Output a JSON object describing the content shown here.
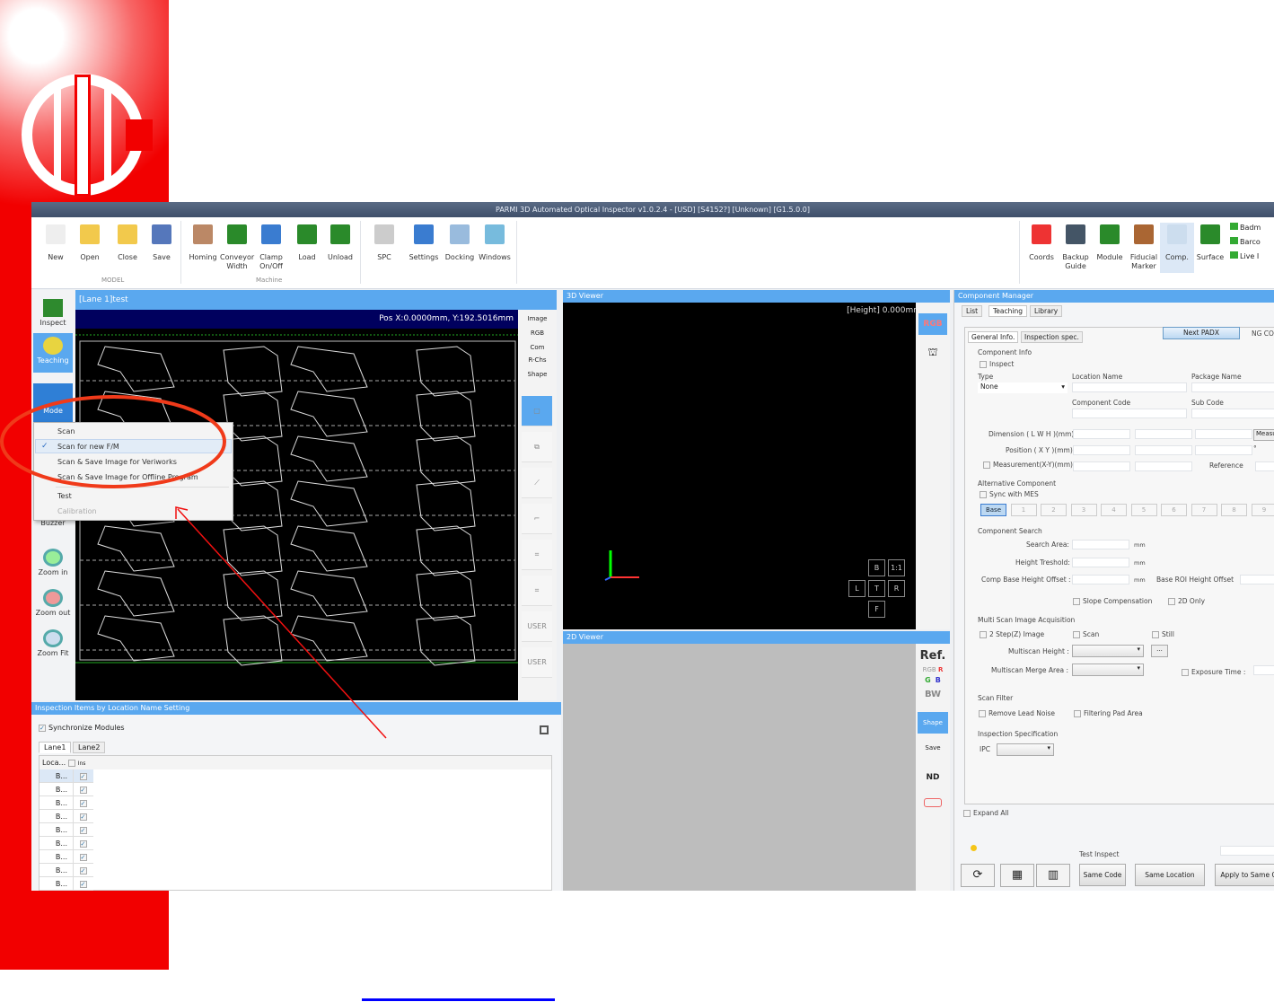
{
  "slide": {
    "link_color": "#0000ff",
    "brand_red": "#f20000"
  },
  "window": {
    "title": "PARMI 3D Automated Optical Inspector v1.0.2.4 - [USD] [S4152?] [Unknown] [G1.5.0.0]"
  },
  "ribbon": {
    "items": [
      {
        "label": "New",
        "icon": "new-file-icon"
      },
      {
        "label": "Open",
        "icon": "open-folder-icon"
      },
      {
        "label": "Close",
        "icon": "close-folder-icon"
      },
      {
        "label": "Save",
        "icon": "save-disk-icon"
      },
      {
        "label": "Homing",
        "icon": "homing-icon"
      },
      {
        "label": "Conveyor Width",
        "icon": "conveyor-icon"
      },
      {
        "label": "Clamp On/Off",
        "icon": "clamp-icon"
      },
      {
        "label": "Load",
        "icon": "load-icon"
      },
      {
        "label": "Unload",
        "icon": "unload-icon"
      },
      {
        "label": "SPC",
        "icon": "spc-icon"
      },
      {
        "label": "Settings",
        "icon": "gear-icon"
      },
      {
        "label": "Docking",
        "icon": "docking-icon"
      },
      {
        "label": "Windows",
        "icon": "windows-icon"
      },
      {
        "label": "Coords",
        "icon": "coords-icon"
      },
      {
        "label": "Backup Guide",
        "icon": "backup-guide-icon"
      },
      {
        "label": "Module",
        "icon": "module-icon"
      },
      {
        "label": "Fiducial Marker",
        "icon": "fiducial-icon"
      },
      {
        "label": "Comp.",
        "icon": "component-icon"
      },
      {
        "label": "Surface",
        "icon": "surface-icon"
      }
    ],
    "groups": [
      "MODEL",
      "Machine"
    ],
    "small_items": [
      "Badm",
      "Barco",
      "Live I"
    ]
  },
  "left_toolbar": {
    "items": [
      "Inspect",
      "Teaching",
      "Mode",
      "Buzzer",
      "Zoom in",
      "Zoom out",
      "Zoom Fit"
    ]
  },
  "mode_menu": {
    "items": [
      "Scan",
      "Scan for new F/M",
      "Scan & Save Image for Veriworks",
      "Scan & Save Image for Offline Program",
      "Test",
      "Calibration"
    ],
    "checked": "Scan for new F/M"
  },
  "main_view": {
    "title": "[Lane 1]test",
    "position": "Pos X:0.0000mm, Y:192.5016mm",
    "side_tools": {
      "image_label": "Image",
      "image_value": "RGB",
      "com_label": "Com",
      "com_value": "R-Chs",
      "shape_label": "Shape",
      "user1": "USER",
      "user2": "USER"
    }
  },
  "viewer3d": {
    "title": "3D Viewer",
    "height": "[Height] 0.000mm",
    "buttons": [
      "B",
      "1:1",
      "L",
      "T",
      "R",
      "F"
    ],
    "rgb": "RGB"
  },
  "viewer2d": {
    "title": "2D Viewer",
    "tools": [
      "Ref.",
      "RGB",
      "R",
      "G",
      "B",
      "BW",
      "Shape",
      "Save",
      "ND"
    ]
  },
  "inspection_items": {
    "title": "Inspection Items by Location Name Setting",
    "sync": "Synchronize Modules",
    "tabs": [
      "Lane1",
      "Lane2"
    ],
    "col_loc": "Loca...",
    "col_ins": "Ins",
    "rows": [
      "B...",
      "B...",
      "B...",
      "B...",
      "B...",
      "B...",
      "B...",
      "B...",
      "B..."
    ]
  },
  "component_manager": {
    "title": "Component Manager",
    "tabs": [
      "List",
      "Teaching",
      "Library"
    ],
    "subtabs": [
      "General Info.",
      "Inspection spec."
    ],
    "next_btn": "Next PADX",
    "ng": "NG COM",
    "component_info": "Component Info",
    "inspect": "Inspect",
    "type_label": "Type",
    "type_value": "None",
    "location_name": "Location Name",
    "package_name": "Package Name",
    "component_code": "Component Code",
    "sub_code": "Sub Code",
    "dimension": "Dimension ( L W H )(mm)",
    "measure_btn": "Measu",
    "position": "Position ( X Y )(mm)",
    "degree": "°",
    "measurement": "Measurement(X-Y)(mm)",
    "reference": "Reference",
    "alt_component": "Alternative Component",
    "sync_mes": "Sync with MES",
    "alt_buttons": [
      "Base",
      "1",
      "2",
      "3",
      "4",
      "5",
      "6",
      "7",
      "8",
      "9"
    ],
    "comp_search": "Component Search",
    "search_area": "Search Area:",
    "height_threshold": "Height Treshold:",
    "comp_base": "Comp Base Height Offset :",
    "unit": "mm",
    "base_roi": "Base ROI Height Offset",
    "slope": "Slope Compensation",
    "only2d": "2D Only",
    "multi_scan": "Multi Scan Image Acquisition",
    "two_step": "2 Step(Z) Image",
    "scan": "Scan",
    "still": "Still",
    "multiscan_height": "Multiscan Height :",
    "browse": "...",
    "merge_area": "Multiscan Merge Area :",
    "exposure": "Exposure Time :",
    "scan_filter": "Scan Filter",
    "remove_lead": "Remove Lead Noise",
    "filter_pad": "Filtering Pad Area",
    "insp_spec": "Inspection Specification",
    "ipc": "IPC",
    "expand_all": "Expand All",
    "test_inspect": "Test Inspect",
    "same_code": "Same Code",
    "same_location": "Same Location",
    "apply_same": "Apply to Same C"
  }
}
